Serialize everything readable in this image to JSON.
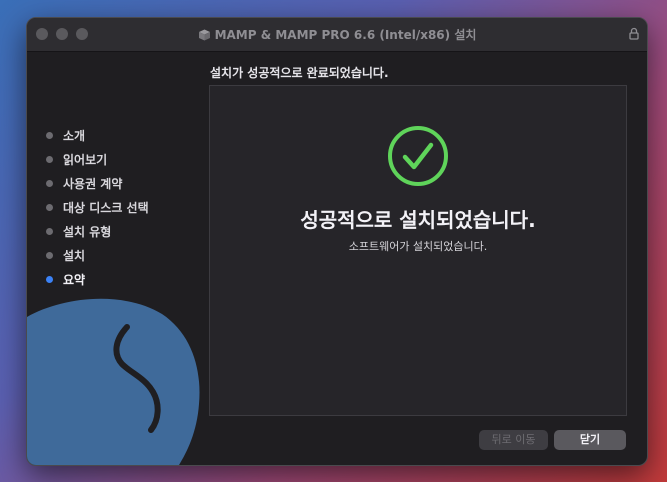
{
  "window": {
    "title": "MAMP & MAMP PRO 6.6 (Intel/x86) 설치"
  },
  "sidebar": {
    "steps": [
      {
        "label": "소개",
        "active": false
      },
      {
        "label": "읽어보기",
        "active": false
      },
      {
        "label": "사용권 계약",
        "active": false
      },
      {
        "label": "대상 디스크 선택",
        "active": false
      },
      {
        "label": "설치 유형",
        "active": false
      },
      {
        "label": "설치",
        "active": false
      },
      {
        "label": "요약",
        "active": true
      }
    ]
  },
  "main": {
    "heading": "설치가 성공적으로 완료되었습니다.",
    "success_title": "성공적으로 설치되었습니다.",
    "success_subtitle": "소프트웨어가 설치되었습니다."
  },
  "buttons": {
    "back_label": "뒤로 이동",
    "close_label": "닫기"
  },
  "colors": {
    "success_green": "#5fd45a",
    "active_dot": "#3b82f6",
    "elephant_blue": "#3f6a9a"
  },
  "icons": [
    "package-icon",
    "lock-icon",
    "checkmark-circle-icon",
    "mamp-elephant-logo"
  ]
}
